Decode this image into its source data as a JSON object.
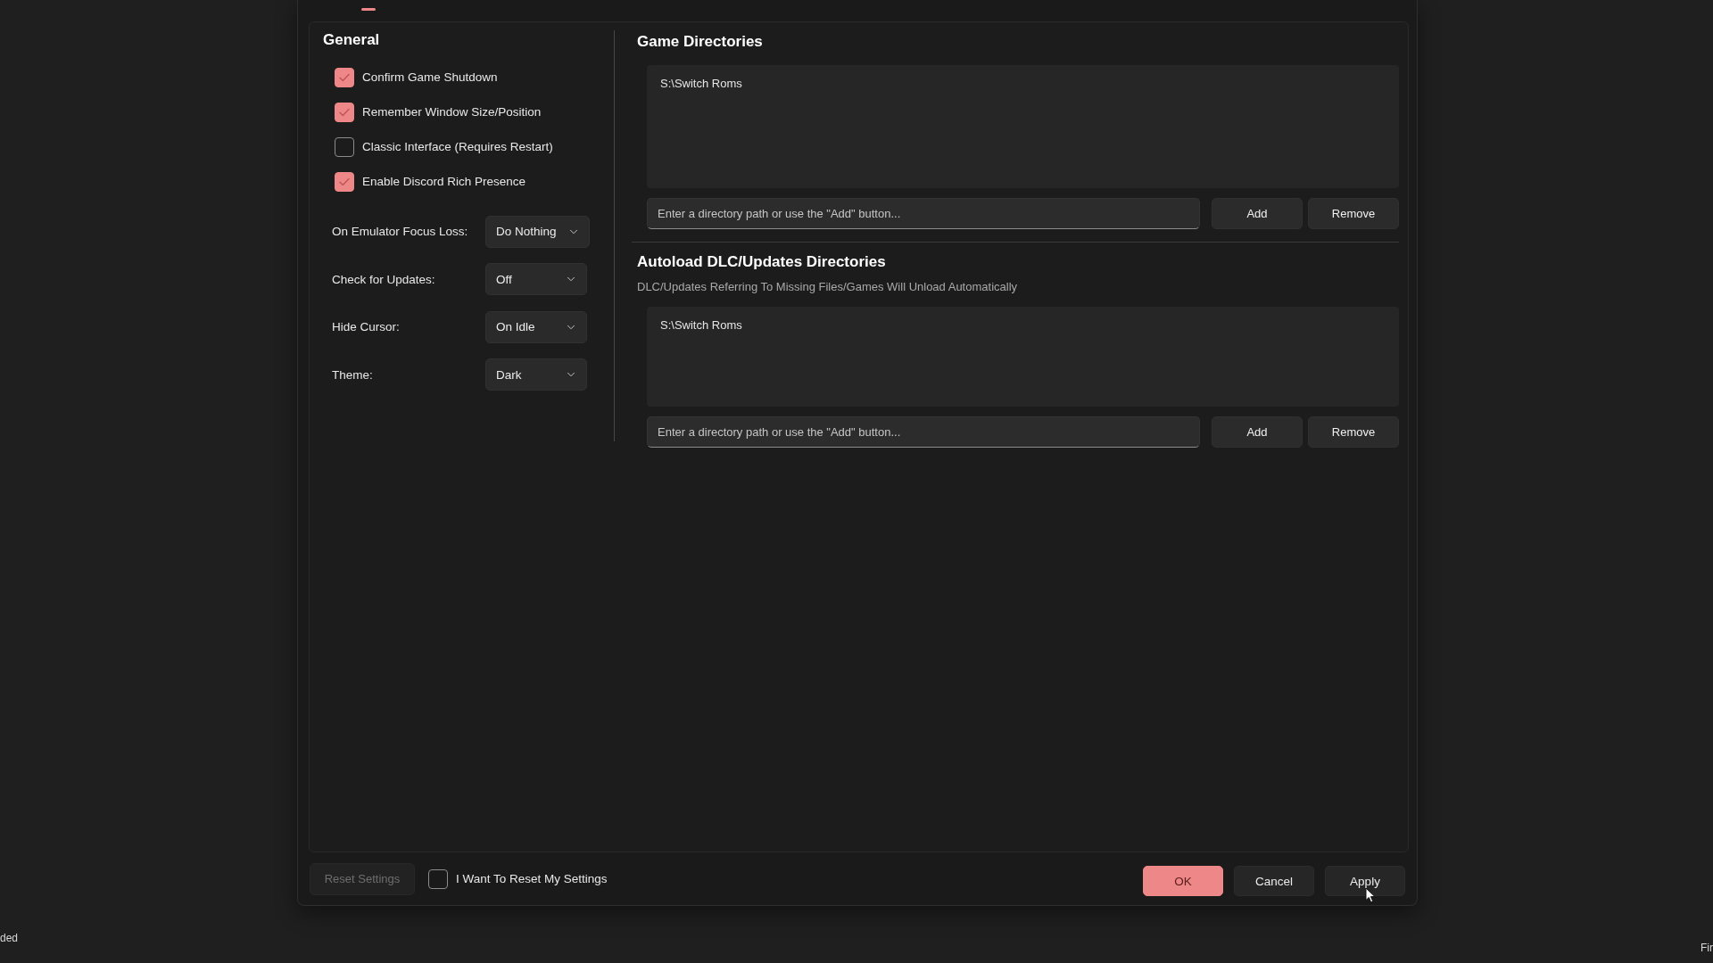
{
  "general": {
    "title": "General",
    "checkboxes": [
      {
        "label": "Confirm Game Shutdown",
        "checked": true
      },
      {
        "label": "Remember Window Size/Position",
        "checked": true
      },
      {
        "label": "Classic Interface (Requires Restart)",
        "checked": false
      },
      {
        "label": "Enable Discord Rich Presence",
        "checked": true
      }
    ],
    "dropdowns": [
      {
        "label": "On Emulator Focus Loss:",
        "value": "Do Nothing"
      },
      {
        "label": "Check for Updates:",
        "value": "Off"
      },
      {
        "label": "Hide Cursor:",
        "value": "On Idle"
      },
      {
        "label": "Theme:",
        "value": "Dark"
      }
    ]
  },
  "directory_sections": [
    {
      "title": "Game Directories",
      "entries": [
        "S:\\Switch Roms"
      ],
      "input": {
        "placeholder": "Enter a directory path or use the \"Add\" button..."
      },
      "buttons": [
        "Add",
        "Remove"
      ]
    },
    {
      "title": "Autoload DLC/Updates Directories",
      "subtitle": "DLC/Updates Referring To Missing Files/Games Will Unload Automatically",
      "entries": [
        "S:\\Switch Roms"
      ],
      "input": {
        "placeholder": "Enter a directory path or use the \"Add\" button..."
      },
      "buttons": [
        "Add",
        "Remove"
      ]
    }
  ],
  "footer": {
    "reset_button": {
      "label": "Reset Settings",
      "disabled": true
    },
    "reset_confirm": {
      "label": "I Want To Reset My Settings",
      "checked": false
    },
    "buttons": [
      {
        "label": "OK",
        "kind": "primary"
      },
      {
        "label": "Cancel",
        "kind": "secondary"
      },
      {
        "label": "Apply",
        "kind": "secondary"
      }
    ]
  },
  "background_texts": [
    "ded",
    "Fir"
  ]
}
